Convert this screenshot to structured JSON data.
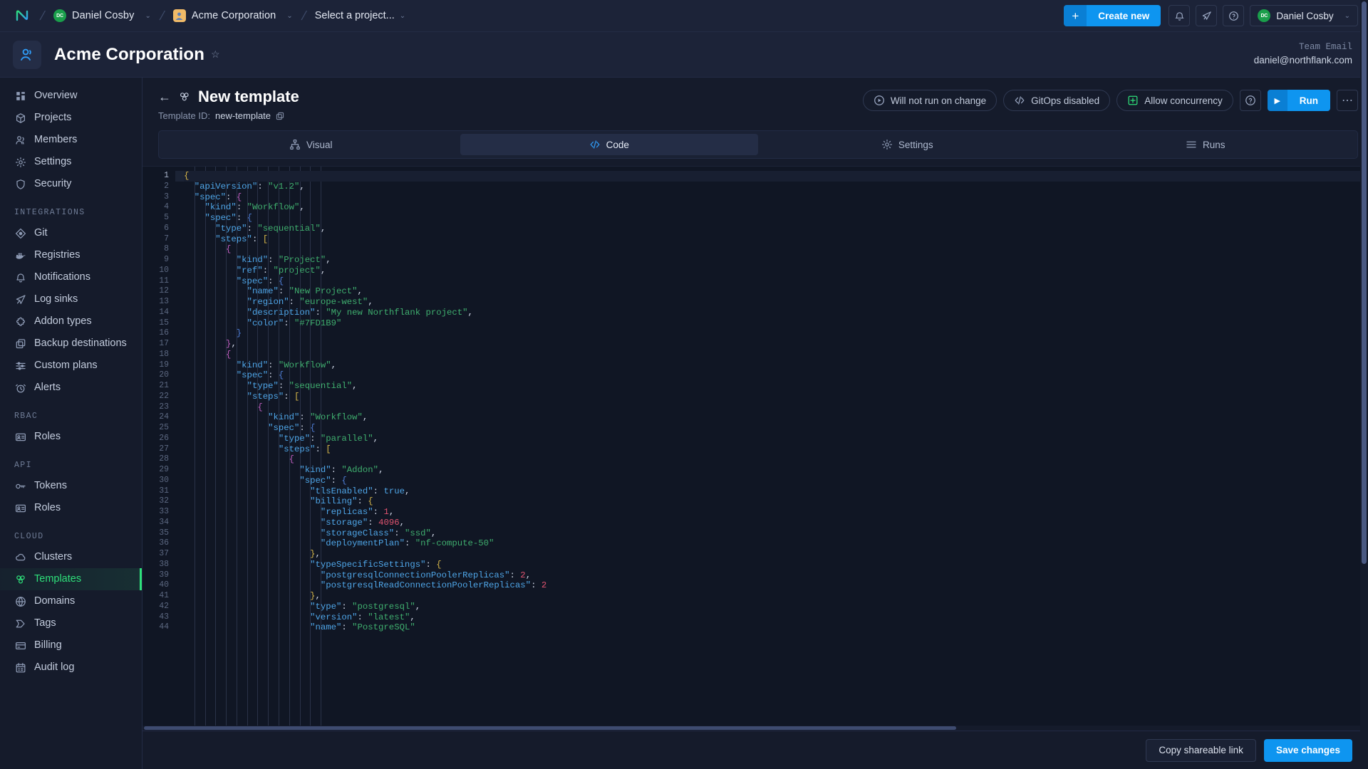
{
  "topbar": {
    "logo_icon": "northflank-logo-icon",
    "user_crumb": {
      "label": "Daniel Cosby",
      "avatar_initials": "DC",
      "caret": "⌄"
    },
    "org_crumb": {
      "label": "Acme Corporation",
      "caret": "⌄"
    },
    "project_crumb": {
      "label": "Select a project...",
      "caret": "⌄"
    },
    "create_new": {
      "plus": "+",
      "label": "Create new"
    },
    "icons": [
      "bell-icon",
      "rocket-icon",
      "help-circle-icon"
    ],
    "account": {
      "label": "Daniel Cosby",
      "avatar_initials": "DC",
      "caret": "⌄"
    }
  },
  "orgbar": {
    "title": "Acme Corporation",
    "star": "☆",
    "team_email_label": "Team Email",
    "team_email_value": "daniel@northflank.com"
  },
  "sidebar": {
    "items": [
      {
        "label": "Overview",
        "icon": "grid-icon",
        "active": false
      },
      {
        "label": "Projects",
        "icon": "box-icon",
        "active": false
      },
      {
        "label": "Members",
        "icon": "people-icon",
        "active": false
      },
      {
        "label": "Settings",
        "icon": "gear-icon",
        "active": false
      },
      {
        "label": "Security",
        "icon": "shield-icon",
        "active": false
      }
    ],
    "groups": [
      {
        "title": "INTEGRATIONS",
        "items": [
          {
            "label": "Git",
            "icon": "git-icon",
            "active": false
          },
          {
            "label": "Registries",
            "icon": "docker-icon",
            "active": false
          },
          {
            "label": "Notifications",
            "icon": "bell-icon",
            "active": false
          },
          {
            "label": "Log sinks",
            "icon": "send-icon",
            "active": false
          },
          {
            "label": "Addon types",
            "icon": "puzzle-icon",
            "active": false
          },
          {
            "label": "Backup destinations",
            "icon": "copy-icon",
            "active": false
          },
          {
            "label": "Custom plans",
            "icon": "sliders-icon",
            "active": false
          },
          {
            "label": "Alerts",
            "icon": "alarm-icon",
            "active": false
          }
        ]
      },
      {
        "title": "RBAC",
        "items": [
          {
            "label": "Roles",
            "icon": "id-card-icon",
            "active": false
          }
        ]
      },
      {
        "title": "API",
        "items": [
          {
            "label": "Tokens",
            "icon": "key-icon",
            "active": false
          },
          {
            "label": "Roles",
            "icon": "id-card-icon",
            "active": false
          }
        ]
      },
      {
        "title": "CLOUD",
        "items": [
          {
            "label": "Clusters",
            "icon": "cloud-icon",
            "active": false
          },
          {
            "label": "Templates",
            "icon": "template-icon",
            "active": true
          },
          {
            "label": "Domains",
            "icon": "globe-icon",
            "active": false
          },
          {
            "label": "Tags",
            "icon": "tag-icon",
            "active": false
          },
          {
            "label": "Billing",
            "icon": "card-icon",
            "active": false
          },
          {
            "label": "Audit log",
            "icon": "calendar-icon",
            "active": false
          }
        ]
      }
    ]
  },
  "template": {
    "back_arrow": "←",
    "title": "New template",
    "title_icon": "template-icon",
    "id_label": "Template ID:",
    "id_value": "new-template",
    "copy_icon": "copy-icon",
    "actions": [
      {
        "label": "Will not run on change",
        "icon": "play-circle-icon",
        "accent": "default"
      },
      {
        "label": "GitOps disabled",
        "icon": "code-icon",
        "accent": "default"
      },
      {
        "label": "Allow concurrency",
        "icon": "layers-plus-icon",
        "accent": "green"
      }
    ],
    "help_icon": "help-circle-icon",
    "run_label": "Run",
    "run_icon": "play-icon",
    "more_icon": "ellipsis-icon",
    "tabs": [
      {
        "label": "Visual",
        "icon": "sitemap-icon",
        "active": false
      },
      {
        "label": "Code",
        "icon": "code-icon",
        "active": true
      },
      {
        "label": "Settings",
        "icon": "gear-icon",
        "active": false
      },
      {
        "label": "Runs",
        "icon": "list-icon",
        "active": false
      }
    ]
  },
  "editor": {
    "language": "json",
    "current_line": 1,
    "lines": [
      {
        "n": 1,
        "indent": 0,
        "tok": [
          [
            "y",
            "{"
          ]
        ]
      },
      {
        "n": 2,
        "indent": 1,
        "tok": [
          [
            "k",
            "\"apiVersion\""
          ],
          [
            "p",
            ": "
          ],
          [
            "s",
            "\"v1.2\""
          ],
          [
            "p",
            ","
          ]
        ]
      },
      {
        "n": 3,
        "indent": 1,
        "tok": [
          [
            "k",
            "\"spec\""
          ],
          [
            "p",
            ": "
          ],
          [
            "m",
            "{"
          ]
        ]
      },
      {
        "n": 4,
        "indent": 2,
        "tok": [
          [
            "k",
            "\"kind\""
          ],
          [
            "p",
            ": "
          ],
          [
            "s",
            "\"Workflow\""
          ],
          [
            "p",
            ","
          ]
        ]
      },
      {
        "n": 5,
        "indent": 2,
        "tok": [
          [
            "k",
            "\"spec\""
          ],
          [
            "p",
            ": "
          ],
          [
            "bl",
            "{"
          ]
        ]
      },
      {
        "n": 6,
        "indent": 3,
        "tok": [
          [
            "k",
            "\"type\""
          ],
          [
            "p",
            ": "
          ],
          [
            "s",
            "\"sequential\""
          ],
          [
            "p",
            ","
          ]
        ]
      },
      {
        "n": 7,
        "indent": 3,
        "tok": [
          [
            "k",
            "\"steps\""
          ],
          [
            "p",
            ": "
          ],
          [
            "y",
            "["
          ]
        ]
      },
      {
        "n": 8,
        "indent": 4,
        "tok": [
          [
            "m",
            "{"
          ]
        ]
      },
      {
        "n": 9,
        "indent": 5,
        "tok": [
          [
            "k",
            "\"kind\""
          ],
          [
            "p",
            ": "
          ],
          [
            "s",
            "\"Project\""
          ],
          [
            "p",
            ","
          ]
        ]
      },
      {
        "n": 10,
        "indent": 5,
        "tok": [
          [
            "k",
            "\"ref\""
          ],
          [
            "p",
            ": "
          ],
          [
            "s",
            "\"project\""
          ],
          [
            "p",
            ","
          ]
        ]
      },
      {
        "n": 11,
        "indent": 5,
        "tok": [
          [
            "k",
            "\"spec\""
          ],
          [
            "p",
            ": "
          ],
          [
            "bl",
            "{"
          ]
        ]
      },
      {
        "n": 12,
        "indent": 6,
        "tok": [
          [
            "k",
            "\"name\""
          ],
          [
            "p",
            ": "
          ],
          [
            "s",
            "\"New Project\""
          ],
          [
            "p",
            ","
          ]
        ]
      },
      {
        "n": 13,
        "indent": 6,
        "tok": [
          [
            "k",
            "\"region\""
          ],
          [
            "p",
            ": "
          ],
          [
            "s",
            "\"europe-west\""
          ],
          [
            "p",
            ","
          ]
        ]
      },
      {
        "n": 14,
        "indent": 6,
        "tok": [
          [
            "k",
            "\"description\""
          ],
          [
            "p",
            ": "
          ],
          [
            "s",
            "\"My new Northflank project\""
          ],
          [
            "p",
            ","
          ]
        ]
      },
      {
        "n": 15,
        "indent": 6,
        "tok": [
          [
            "k",
            "\"color\""
          ],
          [
            "p",
            ": "
          ],
          [
            "s",
            "\"#7FD1B9\""
          ]
        ]
      },
      {
        "n": 16,
        "indent": 5,
        "tok": [
          [
            "bl",
            "}"
          ]
        ]
      },
      {
        "n": 17,
        "indent": 4,
        "tok": [
          [
            "m",
            "}"
          ],
          [
            "p",
            ","
          ]
        ]
      },
      {
        "n": 18,
        "indent": 4,
        "tok": [
          [
            "m",
            "{"
          ]
        ]
      },
      {
        "n": 19,
        "indent": 5,
        "tok": [
          [
            "k",
            "\"kind\""
          ],
          [
            "p",
            ": "
          ],
          [
            "s",
            "\"Workflow\""
          ],
          [
            "p",
            ","
          ]
        ]
      },
      {
        "n": 20,
        "indent": 5,
        "tok": [
          [
            "k",
            "\"spec\""
          ],
          [
            "p",
            ": "
          ],
          [
            "bl",
            "{"
          ]
        ]
      },
      {
        "n": 21,
        "indent": 6,
        "tok": [
          [
            "k",
            "\"type\""
          ],
          [
            "p",
            ": "
          ],
          [
            "s",
            "\"sequential\""
          ],
          [
            "p",
            ","
          ]
        ]
      },
      {
        "n": 22,
        "indent": 6,
        "tok": [
          [
            "k",
            "\"steps\""
          ],
          [
            "p",
            ": "
          ],
          [
            "y",
            "["
          ]
        ]
      },
      {
        "n": 23,
        "indent": 7,
        "tok": [
          [
            "m",
            "{"
          ]
        ]
      },
      {
        "n": 24,
        "indent": 8,
        "tok": [
          [
            "k",
            "\"kind\""
          ],
          [
            "p",
            ": "
          ],
          [
            "s",
            "\"Workflow\""
          ],
          [
            "p",
            ","
          ]
        ]
      },
      {
        "n": 25,
        "indent": 8,
        "tok": [
          [
            "k",
            "\"spec\""
          ],
          [
            "p",
            ": "
          ],
          [
            "bl",
            "{"
          ]
        ]
      },
      {
        "n": 26,
        "indent": 9,
        "tok": [
          [
            "k",
            "\"type\""
          ],
          [
            "p",
            ": "
          ],
          [
            "s",
            "\"parallel\""
          ],
          [
            "p",
            ","
          ]
        ]
      },
      {
        "n": 27,
        "indent": 9,
        "tok": [
          [
            "k",
            "\"steps\""
          ],
          [
            "p",
            ": "
          ],
          [
            "y",
            "["
          ]
        ]
      },
      {
        "n": 28,
        "indent": 10,
        "tok": [
          [
            "m",
            "{"
          ]
        ]
      },
      {
        "n": 29,
        "indent": 11,
        "tok": [
          [
            "k",
            "\"kind\""
          ],
          [
            "p",
            ": "
          ],
          [
            "s",
            "\"Addon\""
          ],
          [
            "p",
            ","
          ]
        ]
      },
      {
        "n": 30,
        "indent": 11,
        "tok": [
          [
            "k",
            "\"spec\""
          ],
          [
            "p",
            ": "
          ],
          [
            "bl",
            "{"
          ]
        ]
      },
      {
        "n": 31,
        "indent": 12,
        "tok": [
          [
            "k",
            "\"tlsEnabled\""
          ],
          [
            "p",
            ": "
          ],
          [
            "b",
            "true"
          ],
          [
            "p",
            ","
          ]
        ]
      },
      {
        "n": 32,
        "indent": 12,
        "tok": [
          [
            "k",
            "\"billing\""
          ],
          [
            "p",
            ": "
          ],
          [
            "y",
            "{"
          ]
        ]
      },
      {
        "n": 33,
        "indent": 13,
        "tok": [
          [
            "k",
            "\"replicas\""
          ],
          [
            "p",
            ": "
          ],
          [
            "n",
            "1"
          ],
          [
            "p",
            ","
          ]
        ]
      },
      {
        "n": 34,
        "indent": 13,
        "tok": [
          [
            "k",
            "\"storage\""
          ],
          [
            "p",
            ": "
          ],
          [
            "n",
            "4096"
          ],
          [
            "p",
            ","
          ]
        ]
      },
      {
        "n": 35,
        "indent": 13,
        "tok": [
          [
            "k",
            "\"storageClass\""
          ],
          [
            "p",
            ": "
          ],
          [
            "s",
            "\"ssd\""
          ],
          [
            "p",
            ","
          ]
        ]
      },
      {
        "n": 36,
        "indent": 13,
        "tok": [
          [
            "k",
            "\"deploymentPlan\""
          ],
          [
            "p",
            ": "
          ],
          [
            "s",
            "\"nf-compute-50\""
          ]
        ]
      },
      {
        "n": 37,
        "indent": 12,
        "tok": [
          [
            "y",
            "}"
          ],
          [
            "p",
            ","
          ]
        ]
      },
      {
        "n": 38,
        "indent": 12,
        "tok": [
          [
            "k",
            "\"typeSpecificSettings\""
          ],
          [
            "p",
            ": "
          ],
          [
            "y",
            "{"
          ]
        ]
      },
      {
        "n": 39,
        "indent": 13,
        "tok": [
          [
            "k",
            "\"postgresqlConnectionPoolerReplicas\""
          ],
          [
            "p",
            ": "
          ],
          [
            "n",
            "2"
          ],
          [
            "p",
            ","
          ]
        ]
      },
      {
        "n": 40,
        "indent": 13,
        "tok": [
          [
            "k",
            "\"postgresqlReadConnectionPoolerReplicas\""
          ],
          [
            "p",
            ": "
          ],
          [
            "n",
            "2"
          ]
        ]
      },
      {
        "n": 41,
        "indent": 12,
        "tok": [
          [
            "y",
            "}"
          ],
          [
            "p",
            ","
          ]
        ]
      },
      {
        "n": 42,
        "indent": 12,
        "tok": [
          [
            "k",
            "\"type\""
          ],
          [
            "p",
            ": "
          ],
          [
            "s",
            "\"postgresql\""
          ],
          [
            "p",
            ","
          ]
        ]
      },
      {
        "n": 43,
        "indent": 12,
        "tok": [
          [
            "k",
            "\"version\""
          ],
          [
            "p",
            ": "
          ],
          [
            "s",
            "\"latest\""
          ],
          [
            "p",
            ","
          ]
        ]
      },
      {
        "n": 44,
        "indent": 12,
        "tok": [
          [
            "k",
            "\"name\""
          ],
          [
            "p",
            ": "
          ],
          [
            "s",
            "\"PostgreSQL\""
          ]
        ]
      }
    ]
  },
  "bottombar": {
    "copy_link_label": "Copy shareable link",
    "save_label": "Save changes"
  }
}
